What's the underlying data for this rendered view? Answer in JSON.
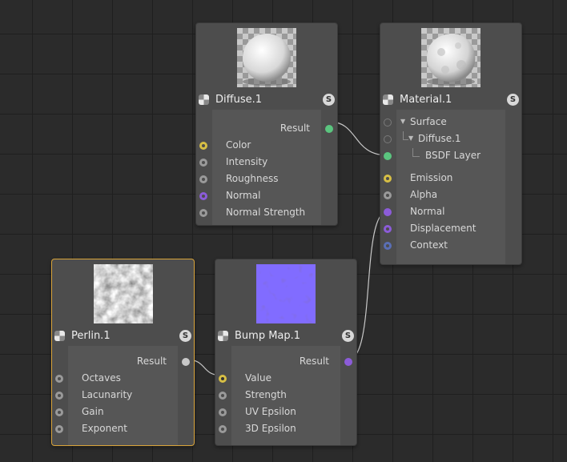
{
  "colors": {
    "background": "#2b2b2b",
    "node": "#4d4d4d",
    "selected_border": "#d9a43a",
    "port_yellow": "#d7bf45",
    "port_gray": "#9a9a9a",
    "port_purple": "#8c5cd9",
    "port_green": "#5bc57f",
    "port_blue": "#5a6fb5"
  },
  "nodes": {
    "diffuse": {
      "title": "Diffuse.1",
      "badge": "S",
      "output": "Result",
      "inputs": [
        "Color",
        "Intensity",
        "Roughness",
        "Normal",
        "Normal Strength"
      ]
    },
    "material": {
      "title": "Material.1",
      "badge": "S",
      "tree": [
        "Surface",
        "Diffuse.1",
        "BSDF Layer"
      ],
      "inputs": [
        "Emission",
        "Alpha",
        "Normal",
        "Displacement",
        "Context"
      ]
    },
    "perlin": {
      "title": "Perlin.1",
      "badge": "S",
      "output": "Result",
      "inputs": [
        "Octaves",
        "Lacunarity",
        "Gain",
        "Exponent"
      ]
    },
    "bump": {
      "title": "Bump Map.1",
      "badge": "S",
      "output": "Result",
      "inputs": [
        "Value",
        "Strength",
        "UV Epsilon",
        "3D Epsilon"
      ]
    }
  }
}
